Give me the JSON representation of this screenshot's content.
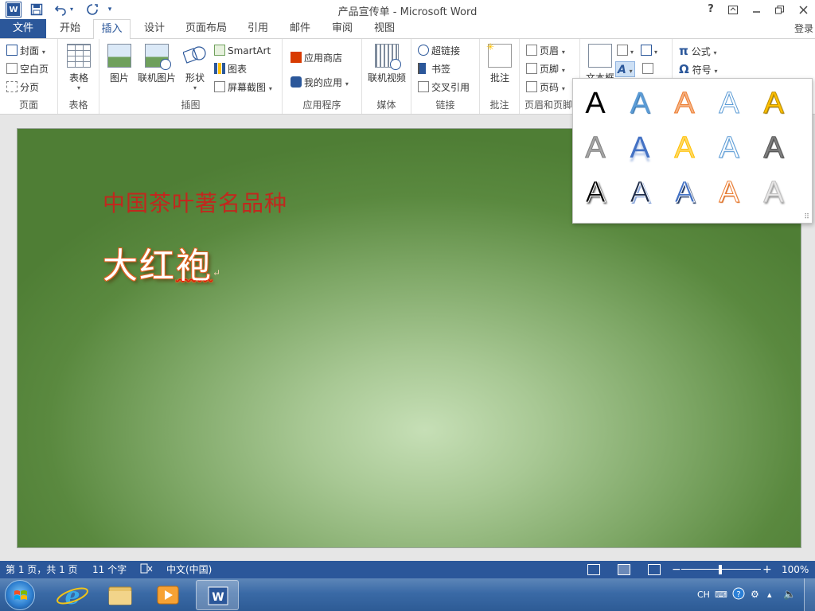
{
  "window": {
    "title": "产品宣传单 - Microsoft Word",
    "app_logo": "W",
    "controls": [
      "?",
      "restore-ribbon",
      "minimize",
      "maximize",
      "close"
    ]
  },
  "tabs": {
    "file": "文件",
    "items": [
      "开始",
      "插入",
      "设计",
      "页面布局",
      "引用",
      "邮件",
      "审阅",
      "视图"
    ],
    "active": "插入",
    "login": "登录"
  },
  "ribbon": {
    "pages": {
      "label": "页面",
      "cover": "封面",
      "blank": "空白页",
      "break": "分页"
    },
    "tables": {
      "label": "表格",
      "table": "表格"
    },
    "illustrations": {
      "label": "插图",
      "picture": "图片",
      "online_picture": "联机图片",
      "shapes": "形状",
      "smartart": "SmartArt",
      "chart": "图表",
      "screenshot": "屏幕截图"
    },
    "apps": {
      "label": "应用程序",
      "store": "应用商店",
      "my_apps": "我的应用"
    },
    "media": {
      "label": "媒体",
      "online_video": "联机视频"
    },
    "links": {
      "label": "链接",
      "hyperlink": "超链接",
      "bookmark": "书签",
      "cross_ref": "交叉引用"
    },
    "comments": {
      "label": "批注",
      "comment": "批注"
    },
    "header_footer": {
      "label": "页眉和页脚",
      "header": "页眉",
      "footer": "页脚",
      "page_number": "页码"
    },
    "text": {
      "textbox": "文本框"
    },
    "symbols": {
      "equation": "公式",
      "symbol": "符号"
    }
  },
  "document": {
    "subtitle": "中国茶叶著名品种",
    "title_a": "大红",
    "title_b": "袍",
    "para_mark": "↵"
  },
  "wordart_gallery": {
    "glyph": "A",
    "styles": [
      {
        "fill": "#000000",
        "stroke": "none",
        "shadow": "none"
      },
      {
        "fill": "#5b9bd5",
        "stroke": "none",
        "shadow": "1px 1px 1px #2e6ea8"
      },
      {
        "fill": "#f4b183",
        "stroke": "#ed7d31",
        "shadow": "none"
      },
      {
        "fill": "#ffffff",
        "stroke": "#5b9bd5",
        "shadow": "none"
      },
      {
        "fill": "#ffc000",
        "stroke": "#bf9000",
        "shadow": "1px 1px 1px #7f6000"
      },
      {
        "fill": "#a6a6a6",
        "stroke": "#808080",
        "shadow": "none"
      },
      {
        "fill": "#4472c4",
        "stroke": "none",
        "shadow": "0 5px 2px rgba(68,114,196,0.35)"
      },
      {
        "fill": "#ffd966",
        "stroke": "#ffc000",
        "shadow": "none"
      },
      {
        "fill": "#ffffff",
        "stroke": "#5b9bd5",
        "shadow": "1px 1px 1px #9dc3e6"
      },
      {
        "fill": "#7f7f7f",
        "stroke": "#595959",
        "shadow": "1px 1px 1px #404040"
      },
      {
        "fill": "#000000",
        "stroke": "#ffffff",
        "shadow": "2px 2px 2px #404040"
      },
      {
        "fill": "#1f2d4a",
        "stroke": "#ffffff",
        "shadow": "2px 2px 0 #8faadc"
      },
      {
        "fill": "#4472c4",
        "stroke": "#ffffff",
        "shadow": "2px 2px 1px #203864"
      },
      {
        "fill": "#ffffff",
        "stroke": "#ed7d31",
        "shadow": "1px 1px 1px #c55a11"
      },
      {
        "fill": "#e7e6e6",
        "stroke": "#bfbfbf",
        "shadow": "1px 2px 2px #7f7f7f"
      }
    ]
  },
  "statusbar": {
    "page": "第 1 页，共 1 页",
    "words": "11 个字",
    "language": "中文(中国)",
    "zoom": "100%",
    "zoom_percent": 100
  },
  "taskbar": {
    "items": [
      "internet-explorer",
      "file-explorer",
      "media-player",
      "word"
    ],
    "active": "word",
    "tray_lang": "CH"
  },
  "colors": {
    "word_blue": "#2b579a",
    "subtitle_red": "#c0281e",
    "title_outline": "#e0601f"
  }
}
